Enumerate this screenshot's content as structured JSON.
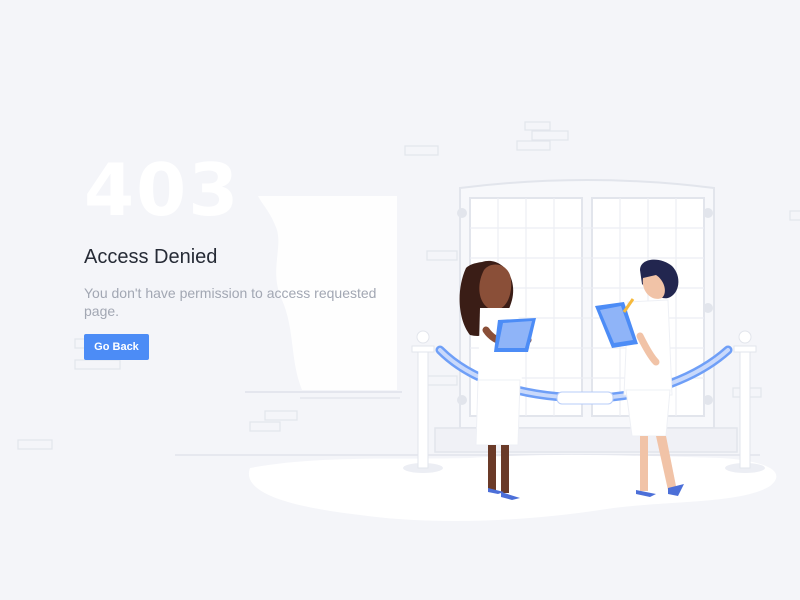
{
  "error": {
    "code": "403",
    "title": "Access Denied",
    "message": "You don't have permission to access requested page.",
    "back_label": "Go Back"
  },
  "illustration": {
    "name": "two-inspectors-at-roped-window-illustration",
    "colors": {
      "background": "#f4f5f9",
      "accent": "#4c8cf6",
      "rope": "#a9c2f7",
      "stone": "#e4e6ee"
    }
  }
}
